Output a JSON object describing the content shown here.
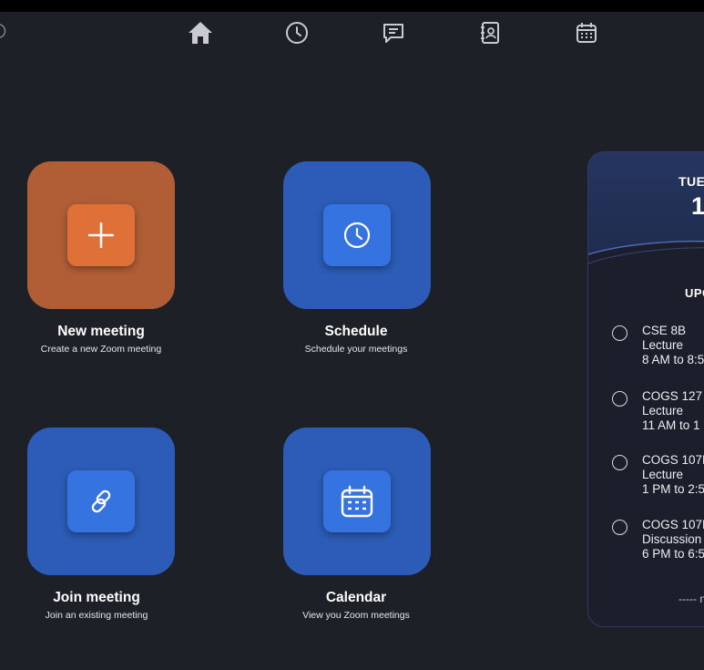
{
  "nav": {
    "items": [
      {
        "name": "home",
        "icon": "home-icon",
        "active": true
      },
      {
        "name": "recent",
        "icon": "clock-icon"
      },
      {
        "name": "chat",
        "icon": "chat-icon"
      },
      {
        "name": "contacts",
        "icon": "contacts-icon"
      },
      {
        "name": "calendar",
        "icon": "calendar-icon"
      }
    ]
  },
  "actions": {
    "new_meeting": {
      "title": "New meeting",
      "subtitle": "Create a new Zoom meeting",
      "icon": "plus-icon",
      "color": "#b15e37"
    },
    "schedule": {
      "title": "Schedule",
      "subtitle": "Schedule your meetings",
      "icon": "clock-icon",
      "color": "#2c5cb7"
    },
    "join": {
      "title": "Join meeting",
      "subtitle": "Join an existing meeting",
      "icon": "link-icon",
      "color": "#2c5cb7"
    },
    "calendar": {
      "title": "Calendar",
      "subtitle": "View you Zoom meetings",
      "icon": "calendar-icon",
      "color": "#2c5cb7"
    }
  },
  "panel": {
    "day": "TUE",
    "date": "1",
    "upcoming_label": "UPC",
    "events": [
      {
        "course": "CSE 8B",
        "type": "Lecture",
        "time": "8 AM to 8:5"
      },
      {
        "course": "COGS 127",
        "type": "Lecture",
        "time": "11 AM to 1"
      },
      {
        "course": "COGS 107E",
        "type": "Lecture",
        "time": "1 PM to 2:5"
      },
      {
        "course": "COGS 107E",
        "type": "Discussion",
        "time": "6 PM to 6:5"
      }
    ],
    "more": "----- n"
  }
}
